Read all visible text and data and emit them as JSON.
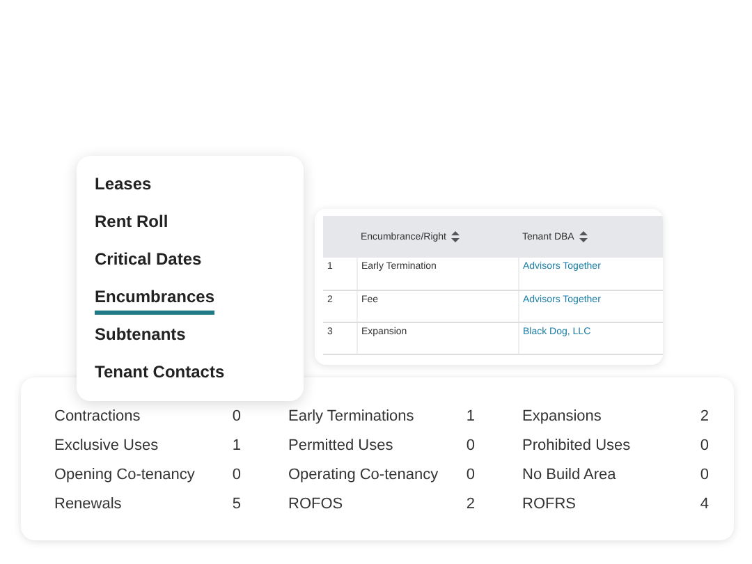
{
  "menu": [
    {
      "label": "Leases",
      "selected": false
    },
    {
      "label": "Rent Roll",
      "selected": false
    },
    {
      "label": "Critical Dates",
      "selected": false
    },
    {
      "label": "Encumbrances",
      "selected": true
    },
    {
      "label": "Subtenants",
      "selected": false
    },
    {
      "label": "Tenant Contacts",
      "selected": false
    }
  ],
  "table": {
    "columns": [
      "Encumbrance/Right",
      "Tenant DBA"
    ],
    "rows": [
      {
        "index": "1",
        "right": "Early Termination",
        "tenant": "Advisors Together"
      },
      {
        "index": "2",
        "right": "Fee",
        "tenant": "Advisors Together"
      },
      {
        "index": "3",
        "right": "Expansion",
        "tenant": "Black Dog, LLC"
      }
    ]
  },
  "summary": [
    {
      "label": "Contractions",
      "count": "0"
    },
    {
      "label": "Early Terminations",
      "count": "1"
    },
    {
      "label": "Expansions",
      "count": "2"
    },
    {
      "label": "Exclusive Uses",
      "count": "1"
    },
    {
      "label": "Permitted Uses",
      "count": "0"
    },
    {
      "label": "Prohibited Uses",
      "count": "0"
    },
    {
      "label": "Opening Co-tenancy",
      "count": "0"
    },
    {
      "label": "Operating Co-tenancy",
      "count": "0"
    },
    {
      "label": "No Build Area",
      "count": "0"
    },
    {
      "label": "Renewals",
      "count": "5"
    },
    {
      "label": "ROFOS",
      "count": "2"
    },
    {
      "label": "ROFRS",
      "count": "4"
    }
  ]
}
